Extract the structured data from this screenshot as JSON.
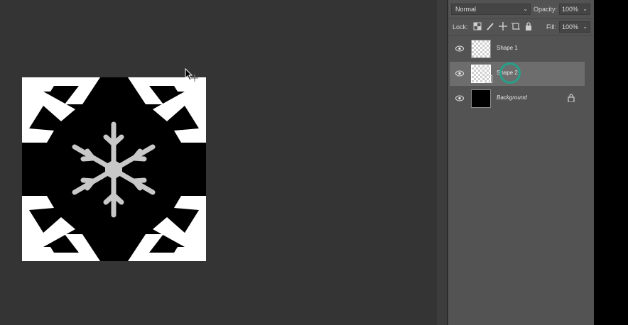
{
  "layers_panel": {
    "blend_mode": "Normal",
    "opacity_label": "Opacity:",
    "opacity_value": "100%",
    "lock_label": "Lock:",
    "fill_label": "Fill:",
    "fill_value": "100%",
    "lock_icons": [
      "lock-transparent-pixels-icon",
      "lock-image-pixels-icon",
      "lock-position-icon",
      "lock-artboard-icon",
      "lock-all-icon"
    ],
    "layers": [
      {
        "name": "Shape 1",
        "thumbnail": "transparent",
        "selected": false,
        "visible": true
      },
      {
        "name": "Shape 2",
        "thumbnail": "transparent",
        "selected": true,
        "visible": true
      },
      {
        "name": "Background",
        "thumbnail": "black",
        "selected": false,
        "visible": true,
        "locked": true
      }
    ]
  },
  "canvas": {
    "background_color": "#000000",
    "tile_color": "#ffffff",
    "snowflake_color": "#c8c8c8"
  },
  "colors": {
    "workspace": "#343434",
    "panel": "#535353",
    "selected_row": "#6d6d6d",
    "click_indicator": "#1fa48c"
  }
}
